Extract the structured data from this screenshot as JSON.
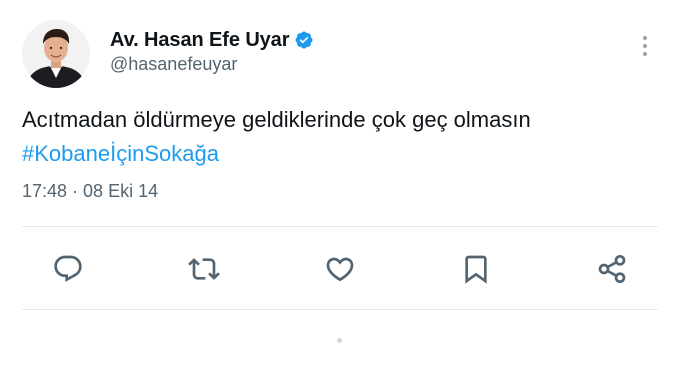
{
  "author": {
    "name": "Av. Hasan Efe Uyar",
    "handle": "@hasanefeuyar",
    "verified": true
  },
  "tweet": {
    "text": "Acıtmadan öldürmeye geldiklerinde çok geç olmasın",
    "hashtag": "#KobaneİçinSokağa",
    "time": "17:48",
    "separator": "·",
    "date": "08 Eki 14"
  },
  "actions": {
    "reply_icon": "reply-icon",
    "retweet_icon": "retweet-icon",
    "like_icon": "like-icon",
    "bookmark_icon": "bookmark-icon",
    "share_icon": "share-icon"
  },
  "colors": {
    "link": "#1d9bf0",
    "secondary_text": "#536471",
    "icon": "#536471",
    "verified_badge": "#1d9bf0",
    "divider": "#e7e9eb"
  }
}
